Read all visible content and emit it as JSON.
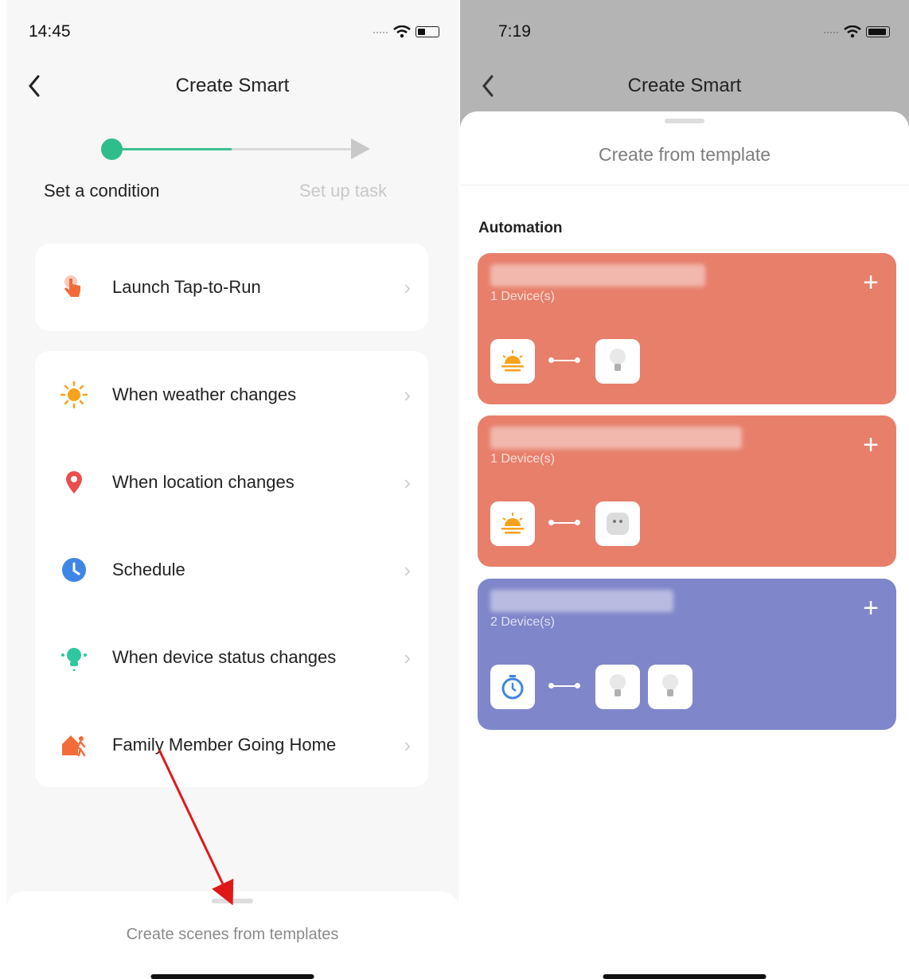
{
  "left": {
    "status_time": "14:45",
    "title": "Create Smart",
    "step1": "Set a condition",
    "step2": "Set up task",
    "launch": "Launch Tap-to-Run",
    "items": [
      {
        "label": "When weather changes",
        "icon": "sun-icon"
      },
      {
        "label": "When location changes",
        "icon": "location-pin-icon"
      },
      {
        "label": "Schedule",
        "icon": "clock-icon"
      },
      {
        "label": "When device status changes",
        "icon": "bulb-icon"
      },
      {
        "label": "Family Member Going Home",
        "icon": "home-person-icon"
      }
    ],
    "sheet_text": "Create scenes from templates"
  },
  "right": {
    "status_time": "7:19",
    "title": "Create Smart",
    "sheet_title": "Create from template",
    "section": "Automation",
    "templates": [
      {
        "devices": "1 Device(s)",
        "color": "#e77f6b",
        "plus": "+"
      },
      {
        "devices": "1 Device(s)",
        "color": "#e77f6b",
        "plus": "+"
      },
      {
        "devices": "2 Device(s)",
        "color": "#7f86c9",
        "plus": "+"
      }
    ]
  },
  "colors": {
    "accent": "#2fbd8b",
    "template_orange": "#e77f6b",
    "template_purple": "#7f86c9"
  }
}
